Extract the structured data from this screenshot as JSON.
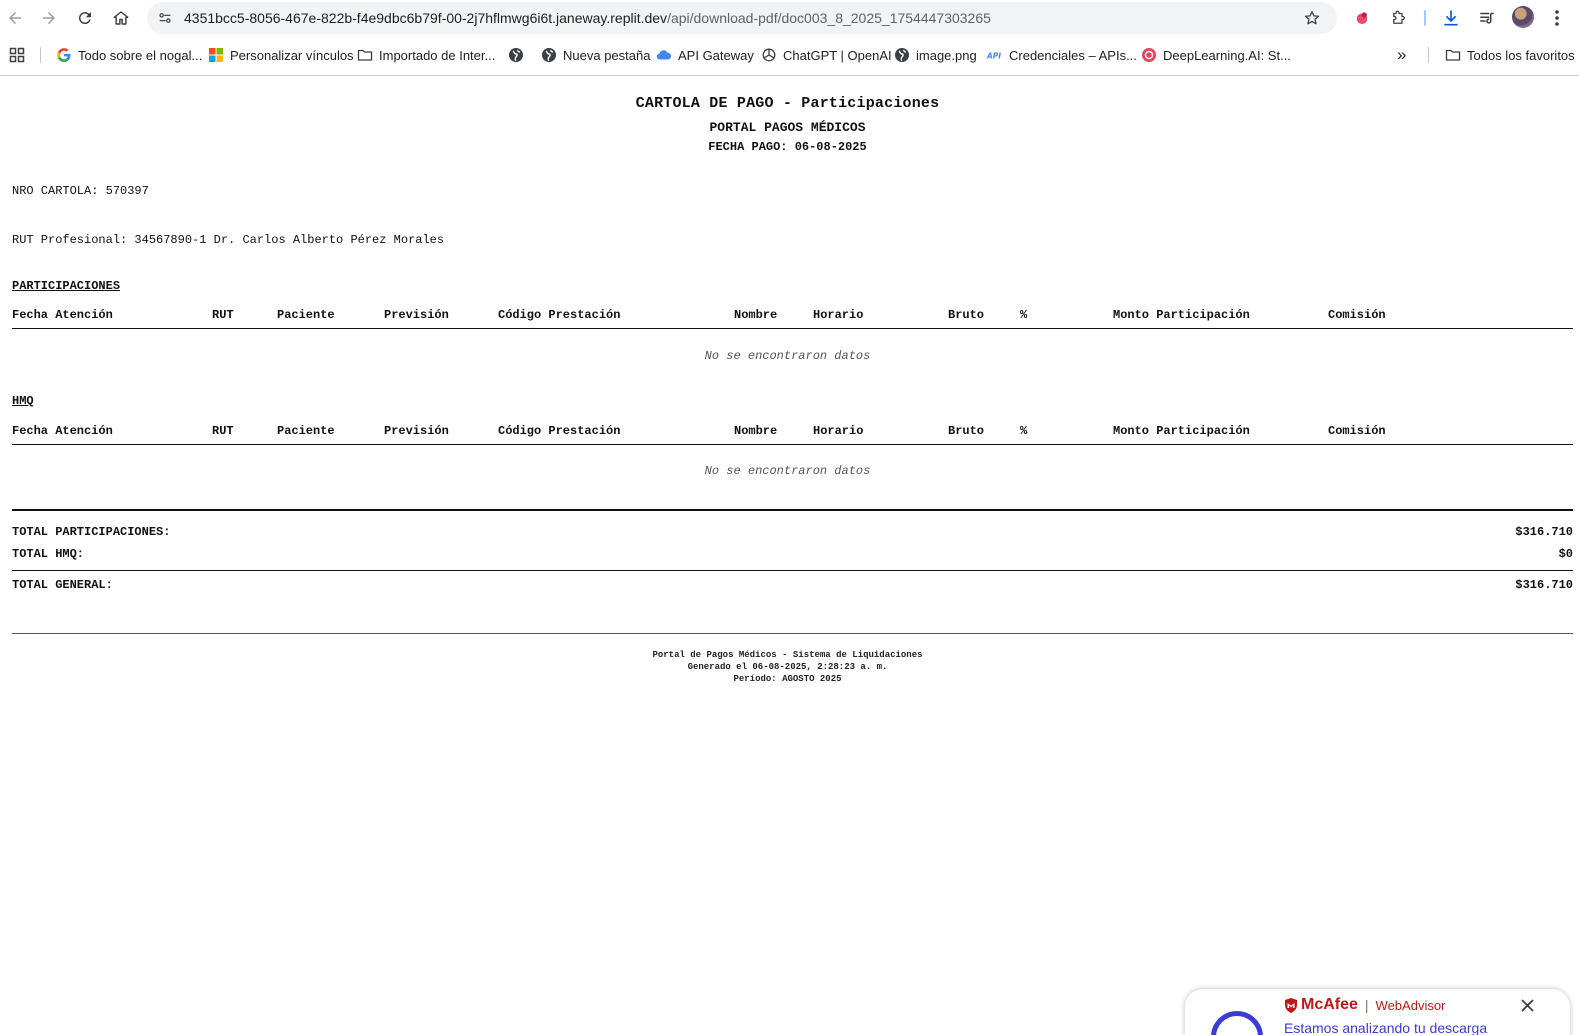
{
  "browser": {
    "url_host": "4351bcc5-8056-467e-822b-f4e9dbc6b79f-00-2j7hflmwg6i6t.janeway.replit.dev",
    "url_path": "/api/download-pdf/doc003_8_2025_1754447303265",
    "icons": [
      "back-icon",
      "forward-icon",
      "reload-icon",
      "home-icon",
      "site-info-icon",
      "star-icon",
      "extension-icon",
      "puzzle-icon",
      "download-icon",
      "media-icon",
      "menu-icon"
    ],
    "bookmarks": [
      {
        "label": "Todo sobre el nogal...",
        "icon": "google-icon"
      },
      {
        "label": "Personalizar vínculos",
        "icon": "microsoft-icon"
      },
      {
        "label": "Importado de Inter...",
        "icon": "folder-icon"
      },
      {
        "label": "",
        "icon": "globe-icon"
      },
      {
        "label": "Nueva pestaña",
        "icon": "globe-icon"
      },
      {
        "label": "API Gateway",
        "icon": "cloud-icon"
      },
      {
        "label": "ChatGPT | OpenAI",
        "icon": "openai-icon"
      },
      {
        "label": "image.png",
        "icon": "globe-icon"
      },
      {
        "label": "Credenciales – APIs...",
        "icon": "api-icon"
      },
      {
        "label": "DeepLearning.AI: St...",
        "icon": "deeplearning-icon"
      }
    ],
    "more_label": "»",
    "all_bookmarks_label": "Todos los favoritos"
  },
  "document": {
    "title": "CARTOLA DE PAGO - Participaciones",
    "subtitle": "PORTAL PAGOS MÉDICOS",
    "payment_date": "FECHA PAGO: 06-08-2025",
    "cartola_number": "NRO CARTOLA: 570397",
    "professional": "RUT Profesional: 34567890-1 Dr. Carlos Alberto Pérez Morales",
    "sections": [
      {
        "title": "PARTICIPACIONES",
        "columns": [
          "Fecha Atención",
          "RUT",
          "Paciente",
          "Previsión",
          "Código Prestación",
          "Nombre",
          "Horario",
          "Bruto",
          "%",
          "Monto Participación",
          "Comisión"
        ],
        "empty_message": "No se encontraron datos"
      },
      {
        "title": "HMQ",
        "columns": [
          "Fecha Atención",
          "RUT",
          "Paciente",
          "Previsión",
          "Código Prestación",
          "Nombre",
          "Horario",
          "Bruto",
          "%",
          "Monto Participación",
          "Comisión"
        ],
        "empty_message": "No se encontraron datos"
      }
    ],
    "totals": [
      {
        "label": "TOTAL PARTICIPACIONES:",
        "value": "$316.710"
      },
      {
        "label": "TOTAL HMQ:",
        "value": "$0"
      },
      {
        "label": "TOTAL GENERAL:",
        "value": "$316.710"
      }
    ],
    "footer": [
      "Portal de Pagos Médicos - Sistema de Liquidaciones",
      "Generado el 06-08-2025, 2:28:23 a. m.",
      "Período: AGOSTO 2025"
    ]
  },
  "popup": {
    "brand": "McAfee",
    "product": "WebAdvisor",
    "message": "Estamos analizando tu descarga"
  },
  "colors": {
    "accent_blue": "#0b57d0",
    "mcafee_red": "#c01818",
    "mcafee_blue": "#3b3bd6"
  }
}
